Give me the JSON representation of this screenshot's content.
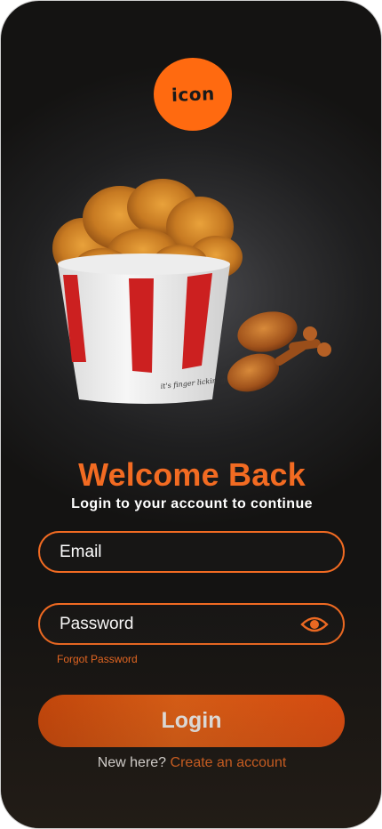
{
  "logo": {
    "text": "icon",
    "color": "#ff6a10"
  },
  "hero": {
    "bucket_caption": "it's finger lickin' good"
  },
  "welcome": {
    "title": "Welcome Back",
    "subtitle": "Login to your account to continue"
  },
  "form": {
    "email_placeholder": "Email",
    "password_placeholder": "Password",
    "password_toggle_icon": "eye-icon",
    "forgot_password": "Forgot Password",
    "login_label": "Login"
  },
  "signup": {
    "prompt": "New here?",
    "link": "Create an account"
  },
  "colors": {
    "accent": "#f26b22",
    "background": "#1e1e1f",
    "text": "#ffffff"
  }
}
